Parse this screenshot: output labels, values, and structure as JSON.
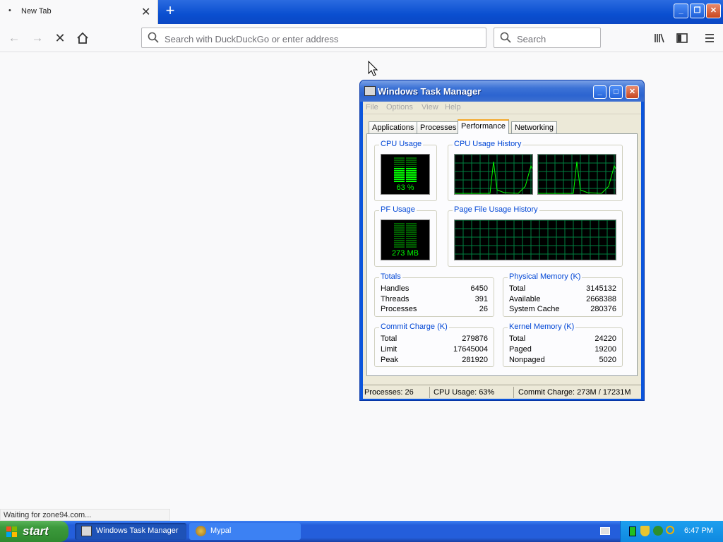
{
  "browser": {
    "tab_title": "New Tab",
    "tab_dot": "•",
    "tab_close": "✕",
    "new_tab": "+",
    "url_placeholder": "Search with DuckDuckGo or enter address",
    "search_placeholder": "Search",
    "status_text": "Waiting for zone94.com..."
  },
  "task_manager": {
    "title": "Windows Task Manager",
    "menu": [
      "File",
      "Options",
      "View",
      "Help"
    ],
    "tabs": [
      "Applications",
      "Processes",
      "Performance",
      "Networking"
    ],
    "active_tab": "Performance",
    "cpu_usage_label": "CPU Usage",
    "cpu_usage_value": "63 %",
    "cpu_history_label": "CPU Usage History",
    "pf_usage_label": "PF Usage",
    "pf_usage_value": "273 MB",
    "pf_history_label": "Page File Usage History",
    "totals": {
      "label": "Totals",
      "rows": [
        {
          "k": "Handles",
          "v": "6450"
        },
        {
          "k": "Threads",
          "v": "391"
        },
        {
          "k": "Processes",
          "v": "26"
        }
      ]
    },
    "physical_memory": {
      "label": "Physical Memory (K)",
      "rows": [
        {
          "k": "Total",
          "v": "3145132"
        },
        {
          "k": "Available",
          "v": "2668388"
        },
        {
          "k": "System Cache",
          "v": "280376"
        }
      ]
    },
    "commit_charge": {
      "label": "Commit Charge (K)",
      "rows": [
        {
          "k": "Total",
          "v": "279876"
        },
        {
          "k": "Limit",
          "v": "17645004"
        },
        {
          "k": "Peak",
          "v": "281920"
        }
      ]
    },
    "kernel_memory": {
      "label": "Kernel Memory (K)",
      "rows": [
        {
          "k": "Total",
          "v": "24220"
        },
        {
          "k": "Paged",
          "v": "19200"
        },
        {
          "k": "Nonpaged",
          "v": "5020"
        }
      ]
    },
    "status": {
      "processes": "Processes: 26",
      "cpu": "CPU Usage: 63%",
      "commit": "Commit Charge: 273M / 17231M"
    },
    "cpu_fraction": 0.63,
    "graph_color": "#00ff00"
  },
  "taskbar": {
    "start_label": "start",
    "items": [
      "Windows Task Manager",
      "Mypal"
    ],
    "clock": "6:47 PM"
  }
}
